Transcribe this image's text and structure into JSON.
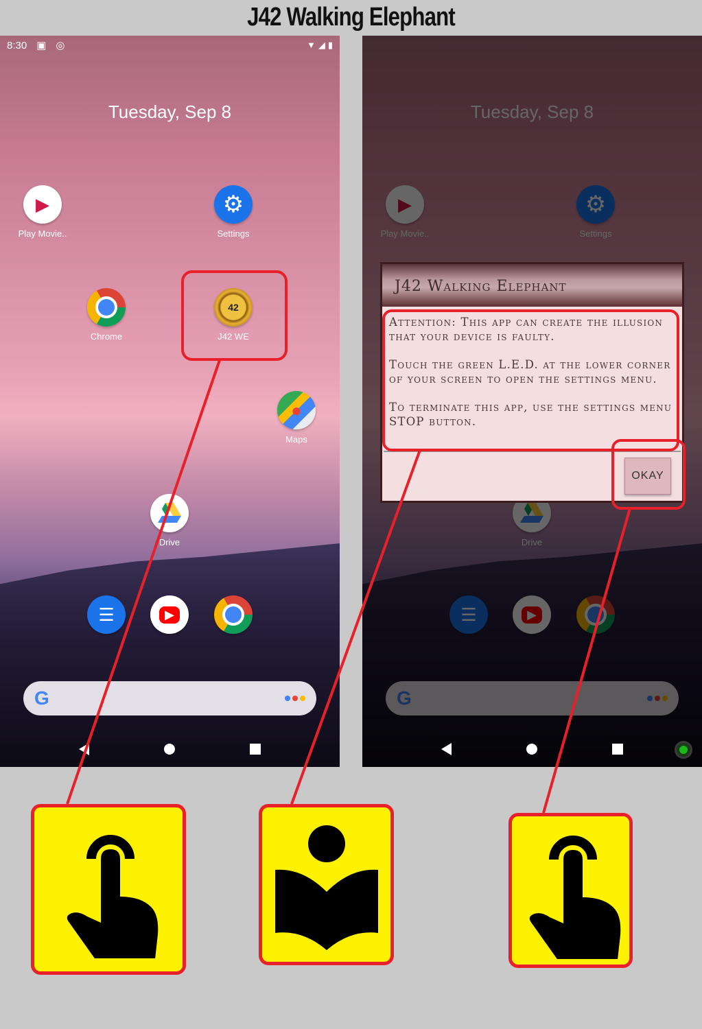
{
  "title": "J42 Walking Elephant",
  "status": {
    "time": "8:30"
  },
  "home": {
    "date": "Tuesday, Sep 8",
    "apps": [
      {
        "label": "Play Movie..",
        "icon": "play-movies-icon"
      },
      {
        "label": "Settings",
        "icon": "settings-gear-icon"
      },
      {
        "label": "Chrome",
        "icon": "chrome-icon"
      },
      {
        "label": "J42 WE",
        "icon": "j42-elephant-icon"
      },
      {
        "label": "Maps",
        "icon": "maps-icon"
      },
      {
        "label": "Drive",
        "icon": "drive-icon"
      }
    ],
    "dock": [
      "messages-icon",
      "youtube-icon",
      "chrome-icon"
    ],
    "search_logo": "G"
  },
  "dialog": {
    "title": "J42 Walking Elephant",
    "paragraphs": [
      "Attention: This app can create the illusion that your device is faulty.",
      "Touch the green L.E.D. at the lower corner of your screen to open the settings menu.",
      "To terminate this app, use the settings menu STOP button."
    ],
    "button": "OKAY"
  },
  "steps": [
    "tap-hand-icon",
    "read-instructions-icon",
    "tap-hand-icon"
  ],
  "colors": {
    "highlight": "#e8202a",
    "step_bg": "#fff200",
    "led": "#1bb81b"
  }
}
